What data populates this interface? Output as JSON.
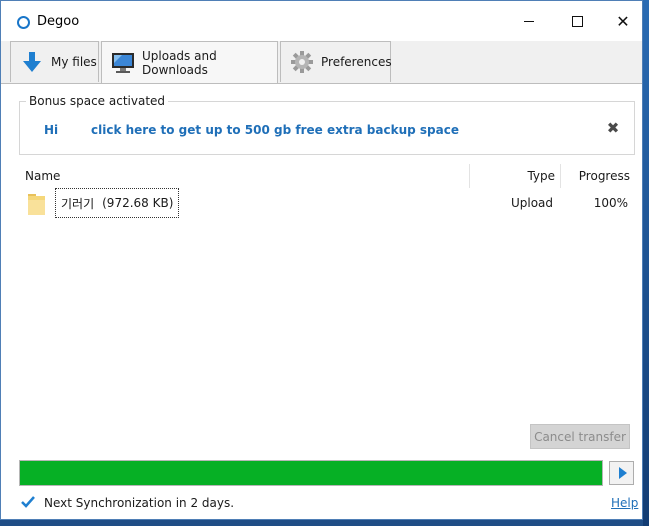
{
  "window": {
    "title": "Degoo"
  },
  "tabs": [
    {
      "label": "My files",
      "icon": "download-arrow-icon"
    },
    {
      "label": "Uploads and Downloads",
      "icon": "computer-monitor-icon"
    },
    {
      "label": "Preferences",
      "icon": "gear-icon"
    }
  ],
  "bonus": {
    "legend": "Bonus space activated",
    "greeting": "Hi",
    "link": "click here to get up to 500 gb free extra backup space"
  },
  "list": {
    "headers": {
      "name": "Name",
      "type": "Type",
      "progress": "Progress"
    },
    "rows": [
      {
        "name": "기러기",
        "size": "(972.68 KB)",
        "type": "Upload",
        "progress": "100%",
        "icon": "folder-icon"
      }
    ]
  },
  "actions": {
    "cancel_label": "Cancel transfer"
  },
  "overall_progress": 1.0,
  "status": {
    "text": "Next Synchronization in 2 days.",
    "help": "Help"
  },
  "colors": {
    "accent": "#1f6fb8",
    "progress": "#06b025"
  }
}
